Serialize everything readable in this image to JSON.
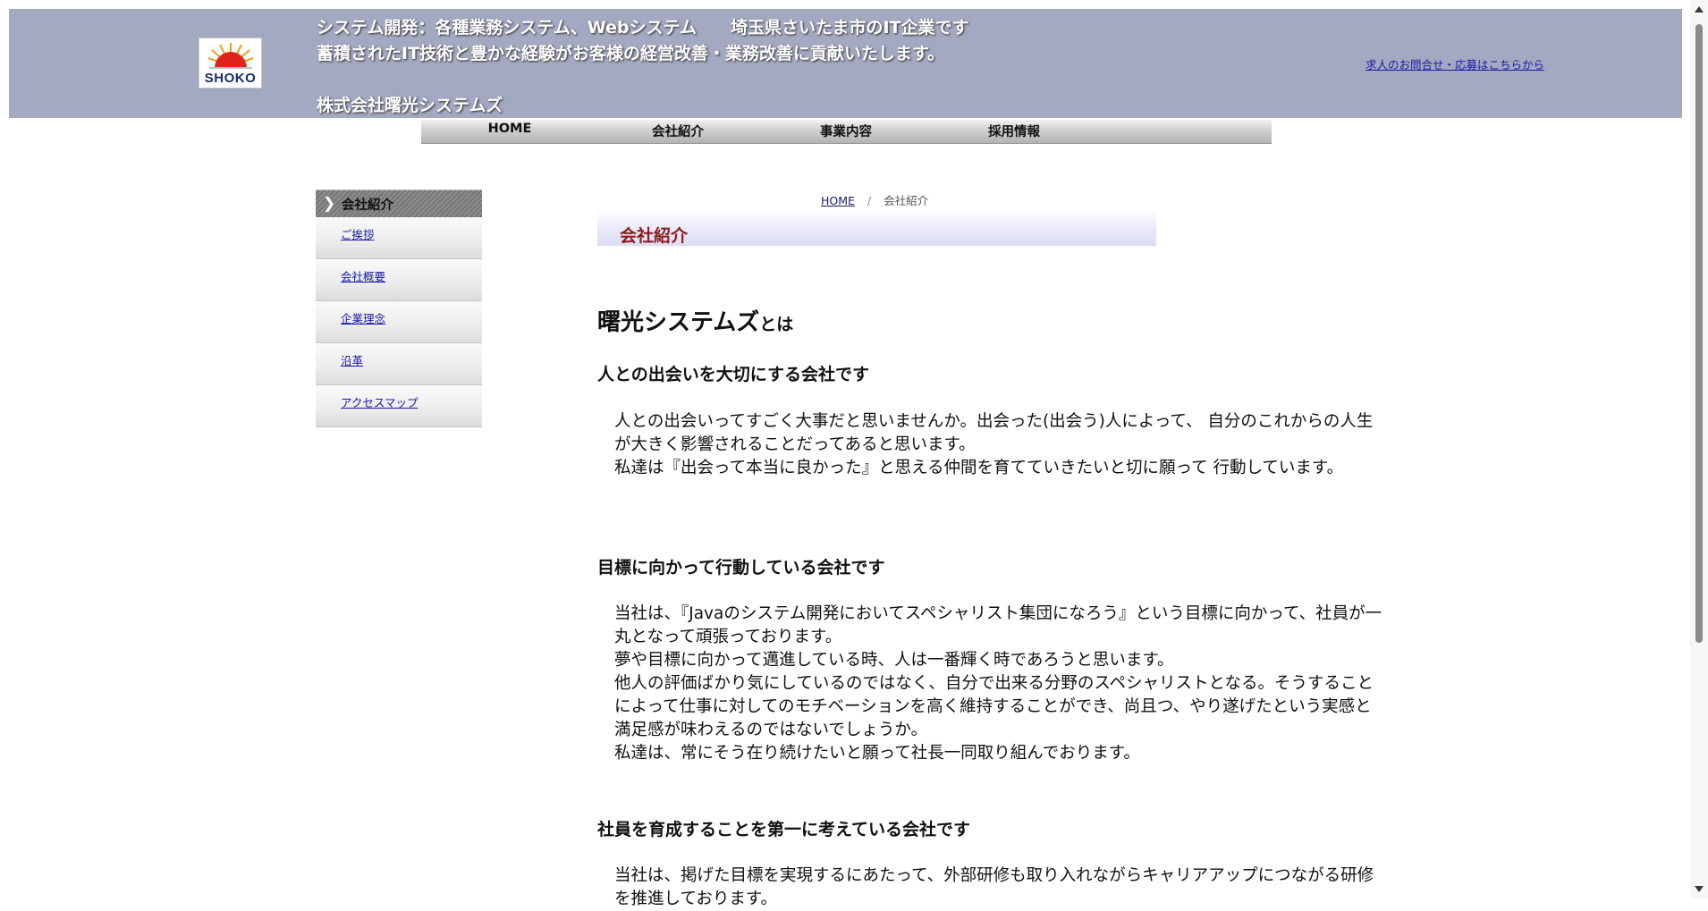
{
  "header": {
    "logo_text": "SHOKO",
    "line1": "システム開発：各種業務システム、Webシステム　　埼玉県さいたま市のIT企業です",
    "line2": "蓄積されたIT技術と豊かな経験がお客様の経営改善・業務改善に貢献いたします。",
    "company_name": "株式会社曙光システムズ",
    "recruit_link": "求人のお問合せ・応募はこちらから"
  },
  "nav": {
    "items": [
      {
        "label": "HOME"
      },
      {
        "label": "会社紹介"
      },
      {
        "label": "事業内容"
      },
      {
        "label": "採用情報"
      }
    ]
  },
  "sidebar": {
    "title": "会社紹介",
    "items": [
      {
        "label": "ご挨拶"
      },
      {
        "label": "会社概要"
      },
      {
        "label": "企業理念"
      },
      {
        "label": "沿革"
      },
      {
        "label": "アクセスマップ"
      }
    ]
  },
  "breadcrumb": {
    "home": "HOME",
    "separator": "/",
    "current": "会社紹介"
  },
  "main": {
    "page_title": "会社紹介",
    "heading_big": "曙光システムズ",
    "heading_small": "とは",
    "sections": [
      {
        "heading": "人との出会いを大切にする会社です",
        "paragraphs": [
          "人との出会いってすごく大事だと思いませんか。出会った(出会う)人によって、 自分のこれからの人生が大きく影響されることだってあると思います。",
          "私達は『出会って本当に良かった』と思える仲間を育てていきたいと切に願って 行動しています。"
        ]
      },
      {
        "heading": "目標に向かって行動している会社です",
        "paragraphs": [
          "当社は、『Javaのシステム開発においてスペシャリスト集団になろう』という目標に向かって、社員が一丸となって頑張っております。",
          "夢や目標に向かって邁進している時、人は一番輝く時であろうと思います。",
          "他人の評価ばかり気にしているのではなく、自分で出来る分野のスペシャリストとなる。そうすることによって仕事に対してのモチベーションを高く維持することができ、尚且つ、やり遂げたという実感と満足感が味わえるのではないでしょうか。",
          "私達は、常にそう在り続けたいと願って社長一同取り組んでおります。"
        ]
      },
      {
        "heading": "社員を育成することを第一に考えている会社です",
        "paragraphs": [
          "当社は、掲げた目標を実現するにあたって、外部研修も取り入れながらキャリアアップにつながる研修を推進しております。"
        ]
      }
    ]
  }
}
